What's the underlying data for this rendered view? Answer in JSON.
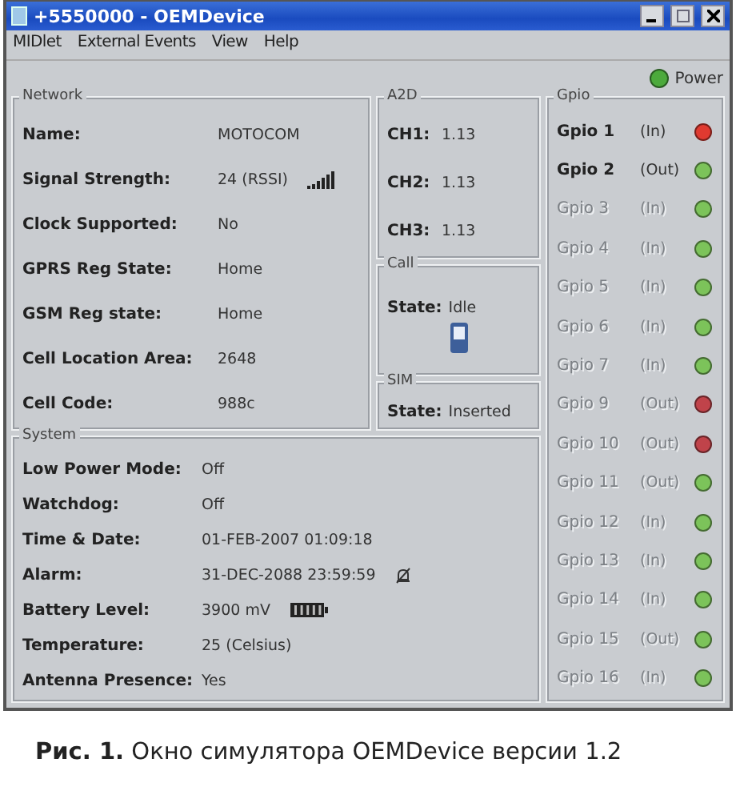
{
  "window": {
    "title": "+5550000 - OEMDevice"
  },
  "menu": [
    {
      "label": "MIDlet"
    },
    {
      "label": "External Events"
    },
    {
      "label": "View"
    },
    {
      "label": "Help"
    }
  ],
  "power": {
    "label": "Power",
    "on": true
  },
  "network": {
    "title": "Network",
    "rows": [
      {
        "label": "Name:",
        "value": "MOTOCOM",
        "kind": "text"
      },
      {
        "label": "Signal Strength:",
        "value": "24 (RSSI)",
        "kind": "signal"
      },
      {
        "label": "Clock Supported:",
        "value": "No",
        "kind": "text"
      },
      {
        "label": "GPRS Reg State:",
        "value": "Home",
        "kind": "text"
      },
      {
        "label": "GSM Reg state:",
        "value": "Home",
        "kind": "text"
      },
      {
        "label": "Cell Location Area:",
        "value": "2648",
        "kind": "text"
      },
      {
        "label": "Cell Code:",
        "value": "988c",
        "kind": "text"
      }
    ]
  },
  "a2d": {
    "title": "A2D",
    "channels": [
      {
        "label": "CH1:",
        "value": "1.13"
      },
      {
        "label": "CH2:",
        "value": "1.13"
      },
      {
        "label": "CH3:",
        "value": "1.13"
      }
    ]
  },
  "call": {
    "title": "Call",
    "label": "State:",
    "value": "Idle"
  },
  "sim": {
    "title": "SIM",
    "label": "State:",
    "value": "Inserted"
  },
  "system": {
    "title": "System",
    "rows": [
      {
        "label": "Low Power Mode:",
        "value": "Off",
        "kind": "text"
      },
      {
        "label": "Watchdog:",
        "value": "Off",
        "kind": "text"
      },
      {
        "label": "Time & Date:",
        "value": "01-FEB-2007  01:09:18",
        "kind": "text"
      },
      {
        "label": "Alarm:",
        "value": "31-DEC-2088 23:59:59",
        "kind": "alarm"
      },
      {
        "label": "Battery Level:",
        "value": "3900  mV",
        "kind": "battery"
      },
      {
        "label": "Temperature:",
        "value": "25 (Celsius)",
        "kind": "text"
      },
      {
        "label": "Antenna Presence:",
        "value": "Yes",
        "kind": "text"
      }
    ]
  },
  "gpio": {
    "title": "Gpio",
    "pins": [
      {
        "name": "Gpio 1",
        "direction": "(In)",
        "disabled": false,
        "color": "#e03a30"
      },
      {
        "name": "Gpio 2",
        "direction": "(Out)",
        "disabled": false,
        "color": "#7cc35a"
      },
      {
        "name": "Gpio 3",
        "direction": "(In)",
        "disabled": true,
        "color": "#7cc35a"
      },
      {
        "name": "Gpio 4",
        "direction": "(In)",
        "disabled": true,
        "color": "#7cc35a"
      },
      {
        "name": "Gpio 5",
        "direction": "(In)",
        "disabled": true,
        "color": "#7cc35a"
      },
      {
        "name": "Gpio 6",
        "direction": "(In)",
        "disabled": true,
        "color": "#7cc35a"
      },
      {
        "name": "Gpio 7",
        "direction": "(In)",
        "disabled": true,
        "color": "#7cc35a"
      },
      {
        "name": "Gpio 9",
        "direction": "(Out)",
        "disabled": true,
        "color": "#c0434a"
      },
      {
        "name": "Gpio 10",
        "direction": "(Out)",
        "disabled": true,
        "color": "#c0434a"
      },
      {
        "name": "Gpio 11",
        "direction": "(Out)",
        "disabled": true,
        "color": "#7cc35a"
      },
      {
        "name": "Gpio 12",
        "direction": "(In)",
        "disabled": true,
        "color": "#7cc35a"
      },
      {
        "name": "Gpio 13",
        "direction": "(In)",
        "disabled": true,
        "color": "#7cc35a"
      },
      {
        "name": "Gpio 14",
        "direction": "(In)",
        "disabled": true,
        "color": "#7cc35a"
      },
      {
        "name": "Gpio 15",
        "direction": "(Out)",
        "disabled": true,
        "color": "#7cc35a"
      },
      {
        "name": "Gpio 16",
        "direction": "(In)",
        "disabled": true,
        "color": "#7cc35a"
      }
    ]
  },
  "caption": {
    "label": "Рис. 1.",
    "text": "Окно симулятора OEMDevice версии 1.2"
  }
}
